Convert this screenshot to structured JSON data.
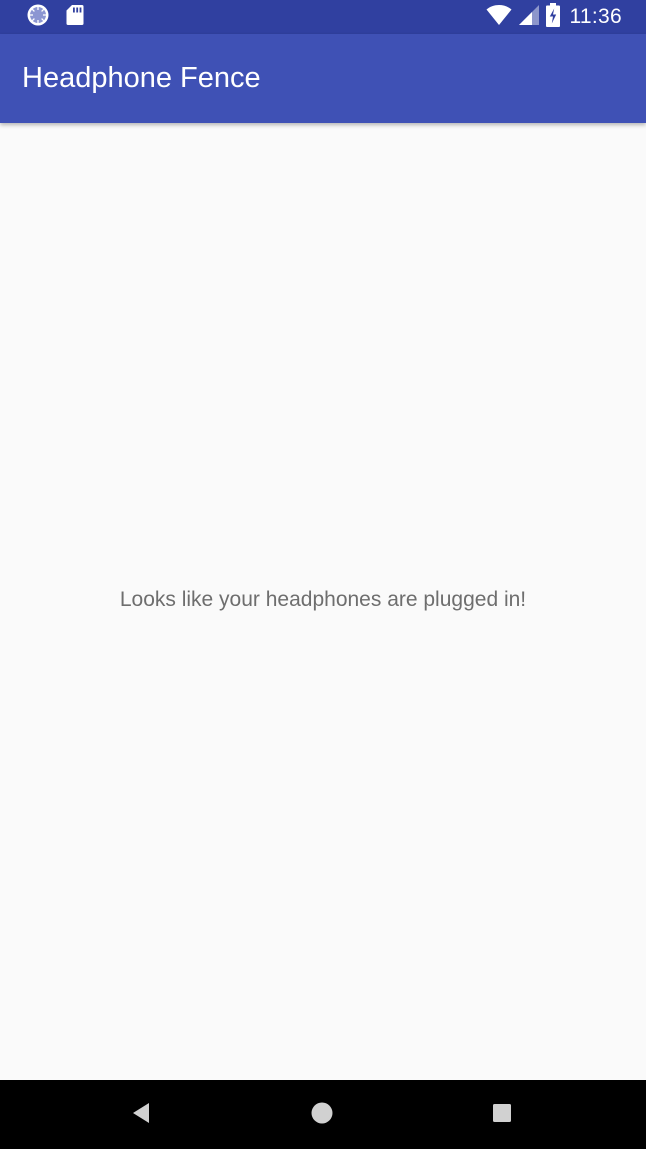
{
  "status_bar": {
    "time": "11:36",
    "icons": [
      "sync-icon",
      "sd-card-icon",
      "wifi-icon",
      "cell-signal-icon",
      "battery-charging-icon"
    ]
  },
  "app_bar": {
    "title": "Headphone Fence"
  },
  "main": {
    "message": "Looks like your headphones are plugged in!"
  },
  "nav_bar": {
    "buttons": [
      "back-icon",
      "home-icon",
      "recents-icon"
    ]
  },
  "colors": {
    "status_bar": "#3040a0",
    "app_bar": "#3f51b5",
    "background": "#fafafa",
    "message_text": "#6e6e6e",
    "nav_bar": "#000000"
  }
}
